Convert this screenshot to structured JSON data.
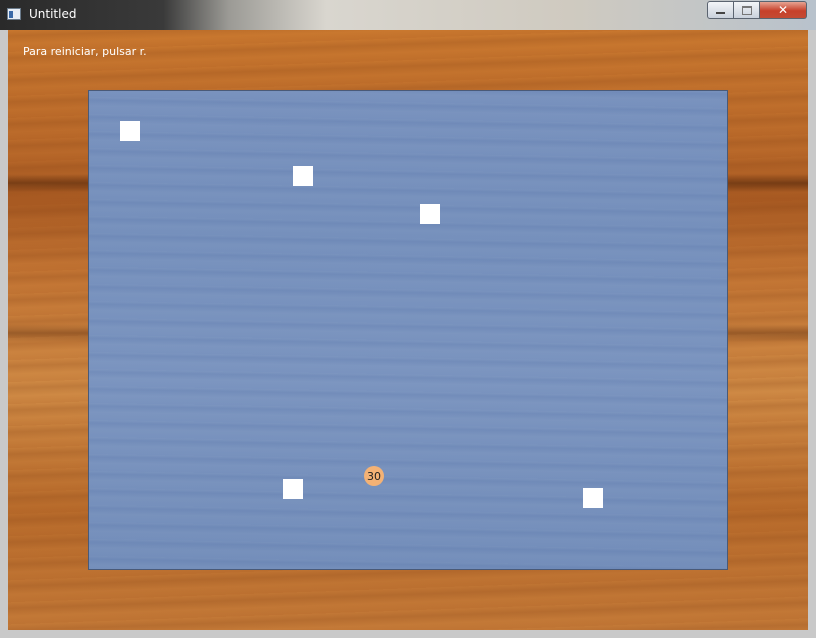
{
  "window": {
    "title": "Untitled",
    "icon": "app-window-icon",
    "controls": {
      "minimize": "",
      "maximize": "",
      "close": "✕"
    }
  },
  "game": {
    "restart_hint": "Para reiniciar, pulsar r.",
    "ball": {
      "label": "30",
      "color": "#f4b275"
    },
    "board_color": "#7a93be",
    "block_color": "#ffffff",
    "block_count": 5
  }
}
